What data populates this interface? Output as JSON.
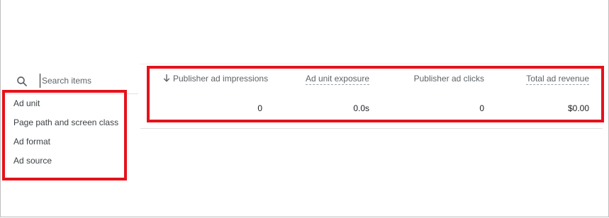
{
  "search": {
    "placeholder": "Search items"
  },
  "items": [
    {
      "label": "Ad unit"
    },
    {
      "label": "Page path and screen class"
    },
    {
      "label": "Ad format"
    },
    {
      "label": "Ad source"
    }
  ],
  "table": {
    "headers": [
      {
        "label": "Publisher ad impressions",
        "sorted": "descending"
      },
      {
        "label": "Ad unit exposure"
      },
      {
        "label": "Publisher ad clicks"
      },
      {
        "label": "Total ad revenue"
      }
    ],
    "totals": [
      "0",
      "0.0s",
      "0",
      "$0.00"
    ]
  },
  "colors": {
    "highlight": "#e5121b",
    "text_primary": "#202124",
    "text_secondary": "#5f6368"
  }
}
